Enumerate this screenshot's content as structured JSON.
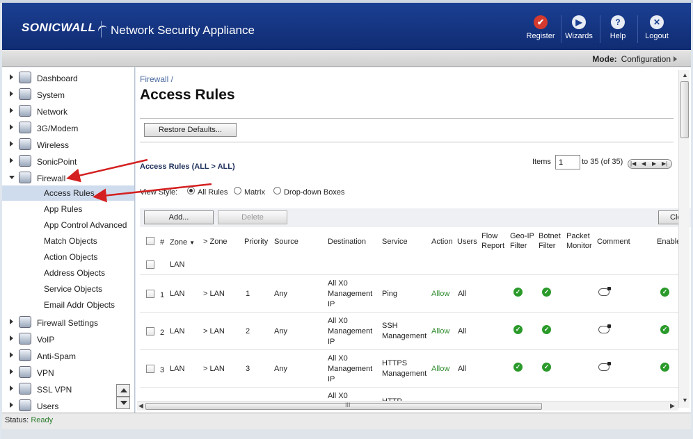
{
  "header": {
    "logo": "SONICWALL",
    "title": "Network Security Appliance",
    "buttons": [
      {
        "label": "Register",
        "icon": "register-icon",
        "glyph": "✔"
      },
      {
        "label": "Wizards",
        "icon": "wizards-icon",
        "glyph": "▶"
      },
      {
        "label": "Help",
        "icon": "help-icon",
        "glyph": "?"
      },
      {
        "label": "Logout",
        "icon": "logout-icon",
        "glyph": "✕"
      }
    ]
  },
  "mode": {
    "label": "Mode:",
    "value": "Configuration"
  },
  "sidebar": {
    "items": [
      {
        "label": "Dashboard",
        "icon": "dashboard-icon"
      },
      {
        "label": "System",
        "icon": "system-icon"
      },
      {
        "label": "Network",
        "icon": "network-icon"
      },
      {
        "label": "3G/Modem",
        "icon": "modem-icon"
      },
      {
        "label": "Wireless",
        "icon": "wireless-icon"
      },
      {
        "label": "SonicPoint",
        "icon": "sonicpoint-icon"
      },
      {
        "label": "Firewall",
        "icon": "firewall-icon",
        "expanded": true
      },
      {
        "label": "Firewall Settings",
        "icon": "firewall-settings-icon"
      },
      {
        "label": "VoIP",
        "icon": "voip-icon"
      },
      {
        "label": "Anti-Spam",
        "icon": "anti-spam-icon"
      },
      {
        "label": "VPN",
        "icon": "vpn-icon"
      },
      {
        "label": "SSL VPN",
        "icon": "ssl-vpn-icon"
      },
      {
        "label": "Users",
        "icon": "users-icon"
      }
    ],
    "firewall_subitems": [
      {
        "label": "Access Rules",
        "selected": true
      },
      {
        "label": "App Rules"
      },
      {
        "label": "App Control Advanced"
      },
      {
        "label": "Match Objects"
      },
      {
        "label": "Action Objects"
      },
      {
        "label": "Address Objects"
      },
      {
        "label": "Service Objects"
      },
      {
        "label": "Email Addr Objects"
      }
    ]
  },
  "main": {
    "breadcrumb": "Firewall /",
    "title": "Access Rules",
    "restore_defaults": "Restore Defaults...",
    "section_title": "Access Rules (ALL > ALL)",
    "items_label": "Items",
    "items_value": "1",
    "items_range": "to 35 (of 35)",
    "view_style_label": "View Style:",
    "view_options": [
      {
        "label": "All Rules",
        "selected": true
      },
      {
        "label": "Matrix"
      },
      {
        "label": "Drop-down Boxes"
      }
    ],
    "add_button": "Add...",
    "delete_button": "Delete",
    "clear_button": "Cle",
    "columns": {
      "num": "#",
      "zone_from": "Zone",
      "zone_to": "> Zone",
      "priority": "Priority",
      "source": "Source",
      "destination": "Destination",
      "service": "Service",
      "action": "Action",
      "users": "Users",
      "flow_report": [
        "Flow",
        "Report"
      ],
      "geo_ip": [
        "Geo-IP",
        "Filter"
      ],
      "botnet": [
        "Botnet",
        "Filter"
      ],
      "packet_monitor": [
        "Packet",
        "Monitor"
      ],
      "comment": "Comment",
      "enable": "Enable"
    },
    "group_label": "LAN",
    "rows": [
      {
        "num": "1",
        "from": "LAN",
        "to": "> LAN",
        "priority": "1",
        "source": "Any",
        "destination": [
          "All X0",
          "Management",
          "IP"
        ],
        "service": [
          "Ping"
        ],
        "action": "Allow",
        "users": "All"
      },
      {
        "num": "2",
        "from": "LAN",
        "to": "> LAN",
        "priority": "2",
        "source": "Any",
        "destination": [
          "All X0",
          "Management",
          "IP"
        ],
        "service": [
          "SSH",
          "Management"
        ],
        "action": "Allow",
        "users": "All"
      },
      {
        "num": "3",
        "from": "LAN",
        "to": "> LAN",
        "priority": "3",
        "source": "Any",
        "destination": [
          "All X0",
          "Management",
          "IP"
        ],
        "service": [
          "HTTPS",
          "Management"
        ],
        "action": "Allow",
        "users": "All"
      }
    ],
    "partial_row": {
      "destination": "All X0",
      "service": "HTTP"
    },
    "hscroll_grip": "III"
  },
  "status": {
    "label": "Status:",
    "value": "Ready"
  },
  "colors": {
    "header_blue": "#12307a",
    "allow_green": "#2e8b2e",
    "selected_bg": "#cfdcee",
    "annotation_red": "#d42020"
  }
}
